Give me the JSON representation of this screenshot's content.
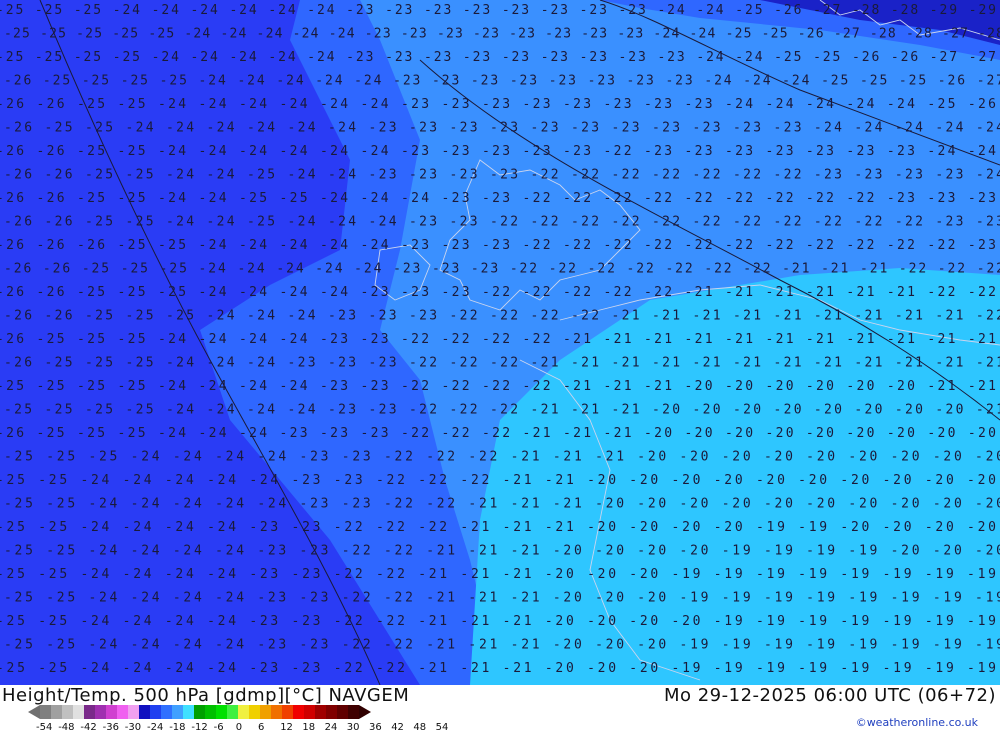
{
  "map": {
    "row_labels": [
      "-25 -25 -25 -24 -24 -24 -24 -24 -24 -23 -23 -23 -23 -23 -23 -23 -23 -24 -24 -25 -26 -27 -28 -28 -29 -29",
      "-25 -25 -25 -25 -25 -24 -24 -24 -24 -24 -23 -23 -23 -23 -23 -23 -23 -23 -24 -24 -25 -25 -26 -27 -28 -28 -27 -28",
      "-25 -25 -25 -25 -24 -24 -24 -24 -24 -23 -23 -23 -23 -23 -23 -23 -23 -23 -24 -24 -25 -25 -26 -26 -27 -27",
      "-26 -25 -25 -25 -25 -24 -24 -24 -24 -24 -23 -23 -23 -23 -23 -23 -23 -23 -24 -24 -24 -25 -25 -25 -26 -27",
      "-26 -26 -25 -25 -24 -24 -24 -24 -24 -24 -23 -23 -23 -23 -23 -23 -23 -23 -24 -24 -24 -24 -24 -25 -26",
      "-26 -25 -25 -24 -24 -24 -24 -24 -24 -23 -23 -23 -23 -23 -23 -23 -23 -23 -23 -23 -24 -24 -24 -24 -24",
      "-26 -26 -25 -25 -24 -24 -24 -24 -24 -24 -23 -23 -23 -23 -23 -22 -23 -23 -23 -23 -23 -23 -23 -24 -24",
      "-26 -26 -25 -25 -24 -24 -25 -24 -24 -23 -23 -23 -23 -22 -22 -22 -22 -22 -22 -22 -23 -23 -23 -23 -24",
      "-26 -26 -25 -25 -24 -24 -25 -25 -24 -24 -24 -23 -23 -22 -22 -22 -22 -22 -22 -22 -22 -22 -23 -23 -23",
      "-26 -26 -25 -25 -24 -24 -25 -24 -24 -24 -23 -23 -22 -22 -22 -22 -22 -22 -22 -22 -22 -22 -22 -23 -23",
      "-26 -26 -26 -25 -25 -24 -24 -24 -24 -24 -23 -23 -23 -22 -22 -22 -22 -22 -22 -22 -22 -22 -22 -22 -23",
      "-26 -26 -25 -25 -25 -24 -24 -24 -24 -24 -23 -23 -23 -22 -22 -22 -22 -22 -22 -22 -21 -21 -21 -22 -22 -22",
      "-26 -26 -25 -25 -25 -24 -24 -24 -24 -23 -23 -23 -22 -22 -22 -22 -22 -21 -21 -21 -21 -21 -21 -22 -22",
      "-26 -26 -25 -25 -25 -24 -24 -24 -23 -23 -23 -22 -22 -22 -22 -21 -21 -21 -21 -21 -21 -21 -21 -21 -22",
      "-26 -25 -25 -25 -24 -24 -24 -24 -23 -23 -22 -22 -22 -22 -21 -21 -21 -21 -21 -21 -21 -21 -21 -21 -21",
      "-26 -25 -25 -25 -24 -24 -24 -23 -23 -23 -22 -22 -22 -21 -21 -21 -21 -21 -21 -21 -21 -21 -21 -21 -21",
      "-25 -25 -25 -25 -24 -24 -24 -24 -23 -23 -22 -22 -22 -22 -21 -21 -21 -20 -20 -20 -20 -20 -20 -21 -21",
      "-25 -25 -25 -25 -24 -24 -24 -24 -23 -23 -22 -22 -22 -21 -21 -21 -20 -20 -20 -20 -20 -20 -20 -20 -21",
      "-26 -25 -25 -25 -24 -24 -24 -23 -23 -23 -22 -22 -22 -21 -21 -21 -20 -20 -20 -20 -20 -20 -20 -20 -20",
      "-25 -25 -25 -24 -24 -24 -24 -23 -23 -22 -22 -22 -21 -21 -21 -20 -20 -20 -20 -20 -20 -20 -20 -20",
      "-25 -25 -24 -24 -24 -24 -24 -23 -23 -22 -22 -22 -21 -21 -20 -20 -20 -20 -20 -20 -20 -20 -20 -20",
      "-25 -25 -24 -24 -24 -24 -24 -23 -23 -22 -22 -21 -21 -21 -20 -20 -20 -20 -20 -20 -20 -20 -20 -20",
      "-25 -25 -24 -24 -24 -24 -23 -23 -22 -22 -22 -21 -21 -21 -20 -20 -20 -20 -19 -19 -20 -20 -20 -20",
      "-25 -25 -24 -24 -24 -24 -23 -23 -22 -22 -21 -21 -21 -20 -20 -20 -20 -19 -19 -19 -19 -20 -20 -20",
      "-25 -25 -24 -24 -24 -24 -23 -23 -22 -22 -21 -21 -21 -20 -20 -20 -19 -19 -19 -19 -19 -19 -19 -19",
      "-25 -25 -24 -24 -24 -24 -23 -23 -22 -22 -21 -21 -21 -20 -20 -20 -19 -19 -19 -19 -19 -19 -19 -19",
      "-25 -25 -24 -24 -24 -24 -23 -23 -22 -22 -21 -21 -21 -20 -20 -20 -20 -19 -19 -19 -19 -19 -19 -19",
      "-25 -25 -24 -24 -24 -24 -23 -23 -22 -22 -21 -21 -21 -20 -20 -20 -19 -19 -19 -19 -19 -19 -19 -19",
      "-25 -25 -24 -24 -24 -24 -23 -23 -22 -22 -21 -21 -21 -20 -20 -20 -19 -19 -19 -19 -19 -19 -19 -19",
      "-25 -25 -24 -24 -24 -24 -23 -23 -22 -22 -21 -21 -21 -20 -20 -20 -19 -19 -19 -19 -19 -19 -19 -19"
    ],
    "colors": {
      "deep_blue": "#2a3cf5",
      "mid_blue": "#2f67ff",
      "light_blue": "#3a90ff",
      "cyan": "#2ec6ff",
      "dark_navy": "#1a22c8",
      "coast": "#c9d4ee",
      "line": "#1a1a3a"
    }
  },
  "footer": {
    "title_left": "Height/Temp. 500 hPa [gdmp][°C] NAVGEM",
    "title_right": "Mo 29-12-2025 06:00 UTC (06+72)",
    "credit": "©weatheronline.co.uk",
    "scale_labels": [
      "-54",
      "-48",
      "-42",
      "-36",
      "-30",
      "-24",
      "-18",
      "-12",
      "-6",
      "0",
      "6",
      "12",
      "18",
      "24",
      "30",
      "36",
      "42",
      "48",
      "54"
    ],
    "scale_colors": [
      "#808080",
      "#a0a0a0",
      "#c0c0c0",
      "#e0e0e0",
      "#7a2a8a",
      "#a030b0",
      "#d040d0",
      "#f060f0",
      "#f0a0f0",
      "#1010c0",
      "#2040f0",
      "#3070ff",
      "#40a0ff",
      "#40e0ff",
      "#00a000",
      "#00c000",
      "#00e000",
      "#40f040",
      "#f0f040",
      "#f0d000",
      "#f0a000",
      "#f07000",
      "#f04000",
      "#f00000",
      "#d00000",
      "#a00000",
      "#800000",
      "#600000",
      "#400000"
    ]
  }
}
